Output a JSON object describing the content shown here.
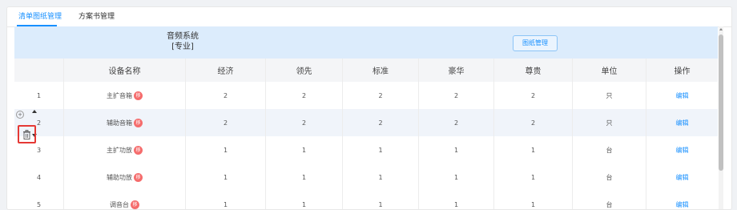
{
  "tabs": [
    "清单图纸管理",
    "方案书管理"
  ],
  "group": {
    "title": "音频系统",
    "subtitle": "[专业]",
    "button_label": "图纸管理"
  },
  "columns": [
    "",
    "设备名称",
    "经济",
    "领先",
    "标准",
    "豪华",
    "尊贵",
    "单位",
    "操作"
  ],
  "rows": [
    {
      "no": "1",
      "name": "主扩音箱",
      "badge": "移",
      "economy": "2",
      "leading": "2",
      "standard": "2",
      "luxury": "2",
      "premium": "2",
      "unit": "只",
      "action": "编辑"
    },
    {
      "no": "2",
      "name": "辅助音箱",
      "badge": "移",
      "economy": "2",
      "leading": "2",
      "standard": "2",
      "luxury": "2",
      "premium": "2",
      "unit": "只",
      "action": "编辑"
    },
    {
      "no": "3",
      "name": "主扩功放",
      "badge": "移",
      "economy": "1",
      "leading": "1",
      "standard": "1",
      "luxury": "1",
      "premium": "1",
      "unit": "台",
      "action": "编辑"
    },
    {
      "no": "4",
      "name": "辅助功放",
      "badge": "移",
      "economy": "1",
      "leading": "1",
      "standard": "1",
      "luxury": "1",
      "premium": "1",
      "unit": "台",
      "action": "编辑"
    },
    {
      "no": "5",
      "name": "调音台",
      "badge": "移",
      "economy": "1",
      "leading": "1",
      "standard": "1",
      "luxury": "1",
      "premium": "1",
      "unit": "台",
      "action": "编辑"
    }
  ],
  "row_controls": {
    "add_icon": "plus-circle-icon",
    "up_icon": "caret-up-icon",
    "down_icon": "caret-down-icon",
    "delete_icon": "trash-icon"
  },
  "colors": {
    "accent": "#1890ff",
    "badge": "#f56c6c",
    "highlight_border": "#e53935",
    "group_header_bg": "#dcecfc"
  }
}
